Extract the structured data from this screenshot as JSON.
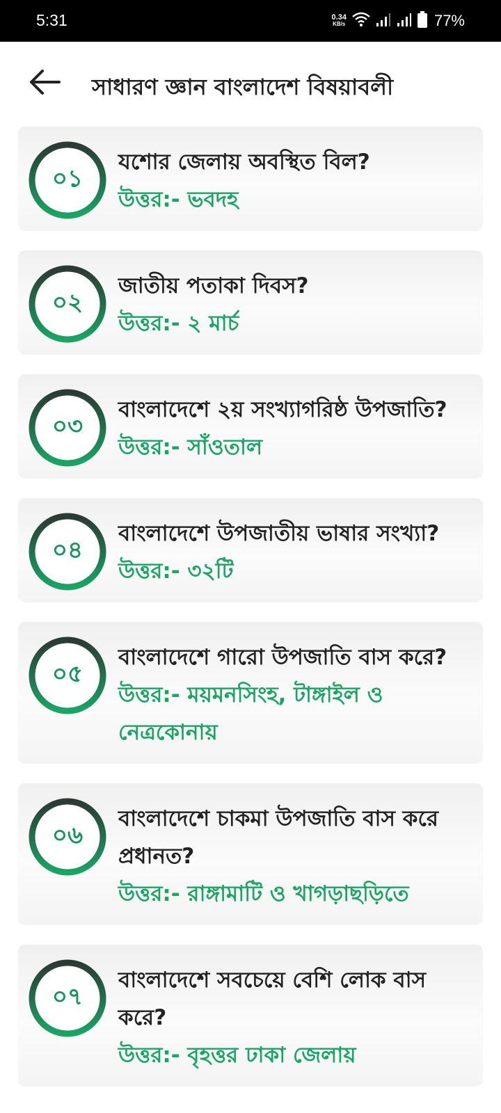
{
  "status_bar": {
    "time": "5:31",
    "net_speed_value": "0.34",
    "net_speed_unit": "KB/s",
    "battery_percent": "77%",
    "icons": [
      "wifi-icon",
      "signal-icon",
      "signal-icon",
      "battery-icon"
    ]
  },
  "app_bar": {
    "back_icon": "arrow-left-icon",
    "title": "সাধারণ জ্ঞান বাংলাদেশ বিষয়াবলী"
  },
  "colors": {
    "accent_green": "#1aa565",
    "ring_dark": "#2b3a33",
    "card_bg": "#f3f3f3",
    "text_dark": "#222222"
  },
  "qa_items": [
    {
      "number": "০১",
      "question": "যশোর জেলায় অবস্থিত বিল?",
      "answer": "উত্তর:- ভবদহ"
    },
    {
      "number": "০২",
      "question": "জাতীয় পতাকা দিবস?",
      "answer": "উত্তর:- ২ মার্চ"
    },
    {
      "number": "০৩",
      "question": "বাংলাদেশে ২য় সংখ্যাগরিষ্ঠ উপজাতি?",
      "answer": "উত্তর:- সাঁওতাল"
    },
    {
      "number": "০৪",
      "question": "বাংলাদেশে উপজাতীয় ভাষার সংখ্যা?",
      "answer": "উত্তর:- ৩২টি"
    },
    {
      "number": "০৫",
      "question": "বাংলাদেশে গারো উপজাতি বাস করে?",
      "answer": "উত্তর:- ময়মনসিংহ, টাঙ্গাইল ও নেত্রকোনায়"
    },
    {
      "number": "০৬",
      "question": "বাংলাদেশে চাকমা উপজাতি বাস করে প্রধানত?",
      "answer": "উত্তর:- রাঙ্গামাটি ও খাগড়াছড়িতে"
    },
    {
      "number": "০৭",
      "question": "বাংলাদেশে সবচেয়ে বেশি লোক বাস করে?",
      "answer": "উত্তর:- বৃহত্তর ঢাকা জেলায়"
    }
  ]
}
